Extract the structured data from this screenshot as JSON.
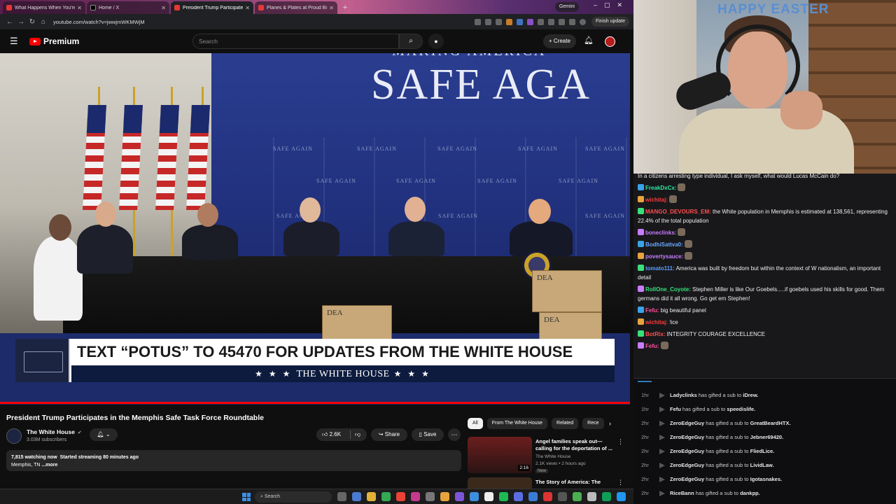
{
  "browser": {
    "tabs": [
      {
        "title": "What Happens When You're A...",
        "favicon": "youtube-icon",
        "active": false
      },
      {
        "title": "Home / X",
        "favicon": "x-icon",
        "active": false
      },
      {
        "title": "President Trump Participates",
        "favicon": "youtube-icon",
        "active": true
      },
      {
        "title": "Planes & Plates at Proud Birdi",
        "favicon": "youtube-icon",
        "active": false
      }
    ],
    "gemini_label": "Gemini",
    "url": "youtube.com/watch?v=jwwjmWKMWjM",
    "finish_update": "Finish update"
  },
  "youtube": {
    "brand": "Premium",
    "search_placeholder": "Search",
    "create_label": "Create",
    "video": {
      "backdrop_top": "MAKING AMERICA",
      "backdrop_title": "SAFE AGA",
      "tile_label": "SAFE AGAIN",
      "box_label": "DEA",
      "lower_third": "TEXT “POTUS” TO 45470 FOR UPDATES FROM THE WHITE HOUSE",
      "lower_bar_stars": "★ ★ ★",
      "lower_bar_text": "THE WHITE HOUSE"
    },
    "title": "President Trump Participates in the Memphis Safe Task Force Roundtable",
    "channel": {
      "name": "The White House",
      "subscribers": "3.03M subscribers"
    },
    "likes": "2.6K",
    "share_label": "Share",
    "save_label": "Save",
    "description": {
      "watching": "7,815 watching now",
      "started": "Started streaming 80 minutes ago",
      "location": "Memphis, TN",
      "more": "...more"
    },
    "chips": [
      "All",
      "From The White House",
      "Related",
      "Rece"
    ],
    "recommendations": [
      {
        "title": "Angel families speak out—calling for the deportation of ...",
        "channel": "The White House",
        "meta": "2.1K views • 2 hours ago",
        "badge": "New",
        "duration": "2:16"
      },
      {
        "title": "The Story of America: The"
      }
    ]
  },
  "taskbar": {
    "search_label": "Search"
  },
  "webcam": {
    "banner": "HAPPY EASTER"
  },
  "chat": {
    "messages": [
      {
        "user": "FreakDxCx:",
        "text": "",
        "color": "#2ee8a1"
      },
      {
        "user": "wichitaj:",
        "text": "",
        "color": "#ff3b3b"
      },
      {
        "user": "MANGO_DEVOURS_EM:",
        "text": "the White population in Memphis is estimated at 138,561, representing 22.4% of the total population",
        "color": "#ff4f4f"
      },
      {
        "user": "boneclinks:",
        "text": "",
        "color": "#c77dff"
      },
      {
        "user": "BodhiSattva0:",
        "text": "",
        "color": "#6aa8ff"
      },
      {
        "user": "povertysauce:",
        "text": "",
        "color": "#c77dff"
      },
      {
        "user": "tomato111:",
        "text": "America was built by freedom but within the context of W nationalism, an important detail",
        "color": "#5aa0ff"
      },
      {
        "user": "RollOne_Coyote:",
        "text": "Stephen Miller is like Our Goebels.....if goebels used his skills for good. Them germans did it all wrong. Go get em Stephen!",
        "color": "#39e07a"
      },
      {
        "user": "Fefu:",
        "text": "big beautiful panel",
        "color": "#ff4f9a"
      },
      {
        "user": "wichitaj:",
        "text": "!ice",
        "color": "#ff3b3b"
      },
      {
        "user": "BotRix:",
        "text": "INTEGRITY COURAGE EXCELLENCE",
        "color": "#ff4f4f"
      },
      {
        "user": "Fefu:",
        "text": "",
        "color": "#ff4f9a"
      }
    ],
    "top_partial": "In a citizens arresting type individual, I ask myself, what would Lucas McCain do?"
  },
  "subs": [
    {
      "time": "1hr",
      "gifter": "Ladyclinks",
      "mid": "has gifted a sub to",
      "to": "iDrew."
    },
    {
      "time": "1hr",
      "gifter": "Fefu",
      "mid": "has gifted a sub to",
      "to": "speedislife."
    },
    {
      "time": "2hr",
      "gifter": "ZeroEdgeGuy",
      "mid": "has gifted a sub to",
      "to": "GreatBeardHTX."
    },
    {
      "time": "2hr",
      "gifter": "ZeroEdgeGuy",
      "mid": "has gifted a sub to",
      "to": "Jebner69420."
    },
    {
      "time": "2hr",
      "gifter": "ZeroEdgeGuy",
      "mid": "has gifted a sub to",
      "to": "FliedLice."
    },
    {
      "time": "2hr",
      "gifter": "ZeroEdgeGuy",
      "mid": "has gifted a sub to",
      "to": "LividLaw."
    },
    {
      "time": "2hr",
      "gifter": "ZeroEdgeGuy",
      "mid": "has gifted a sub to",
      "to": "Igotasnakes."
    },
    {
      "time": "2hr",
      "gifter": "RiceBann",
      "mid": "has gifted a sub to",
      "to": "dankpp."
    }
  ]
}
